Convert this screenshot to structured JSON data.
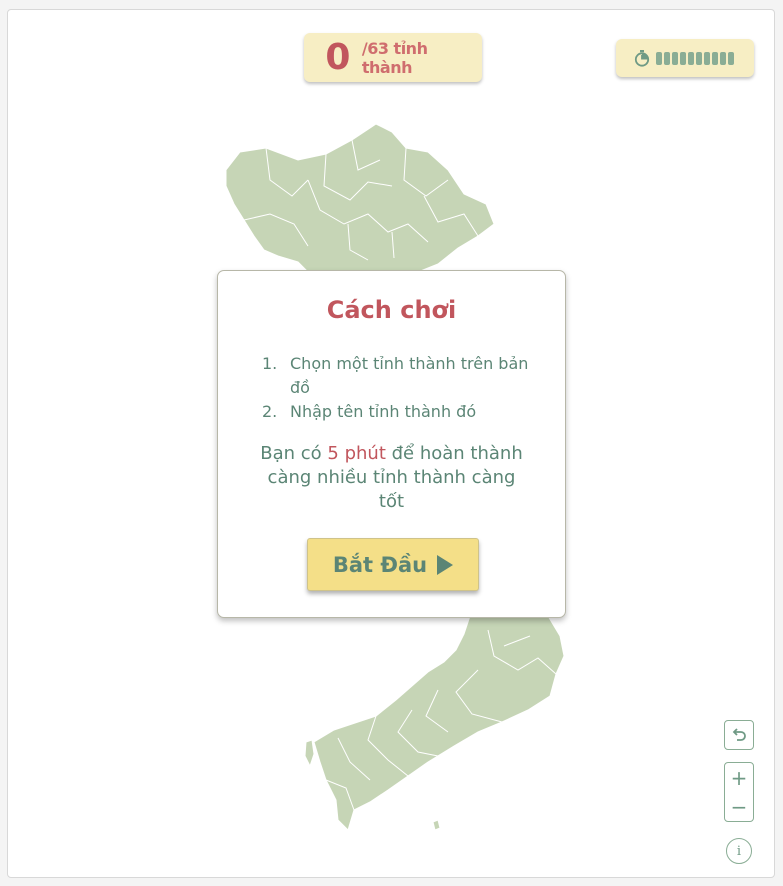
{
  "score": {
    "count": "0",
    "total_label": "/63 tỉnh thành"
  },
  "timer": {
    "icon": "stopwatch-icon",
    "remaining_fraction": 1.0,
    "segments": 10
  },
  "modal": {
    "title": "Cách chơi",
    "steps": [
      {
        "number": "1.",
        "text": "Chọn một tỉnh thành trên bản đồ"
      },
      {
        "number": "2.",
        "text": "Nhập tên tỉnh thành đó"
      }
    ],
    "desc_prefix": "Bạn có ",
    "desc_highlight": "5 phút",
    "desc_suffix": " để hoàn thành càng nhiều tỉnh thành càng tốt",
    "start_label": "Bắt Đầu"
  },
  "controls": {
    "undo_icon": "undo-icon",
    "zoom_in": "+",
    "zoom_out": "−",
    "info": "i"
  },
  "colors": {
    "map_fill": "#c6d5b6",
    "accent_red": "#c1565d",
    "text_green": "#5b8575",
    "panel_yellow": "#f7eec4",
    "button_yellow": "#f4df88"
  }
}
